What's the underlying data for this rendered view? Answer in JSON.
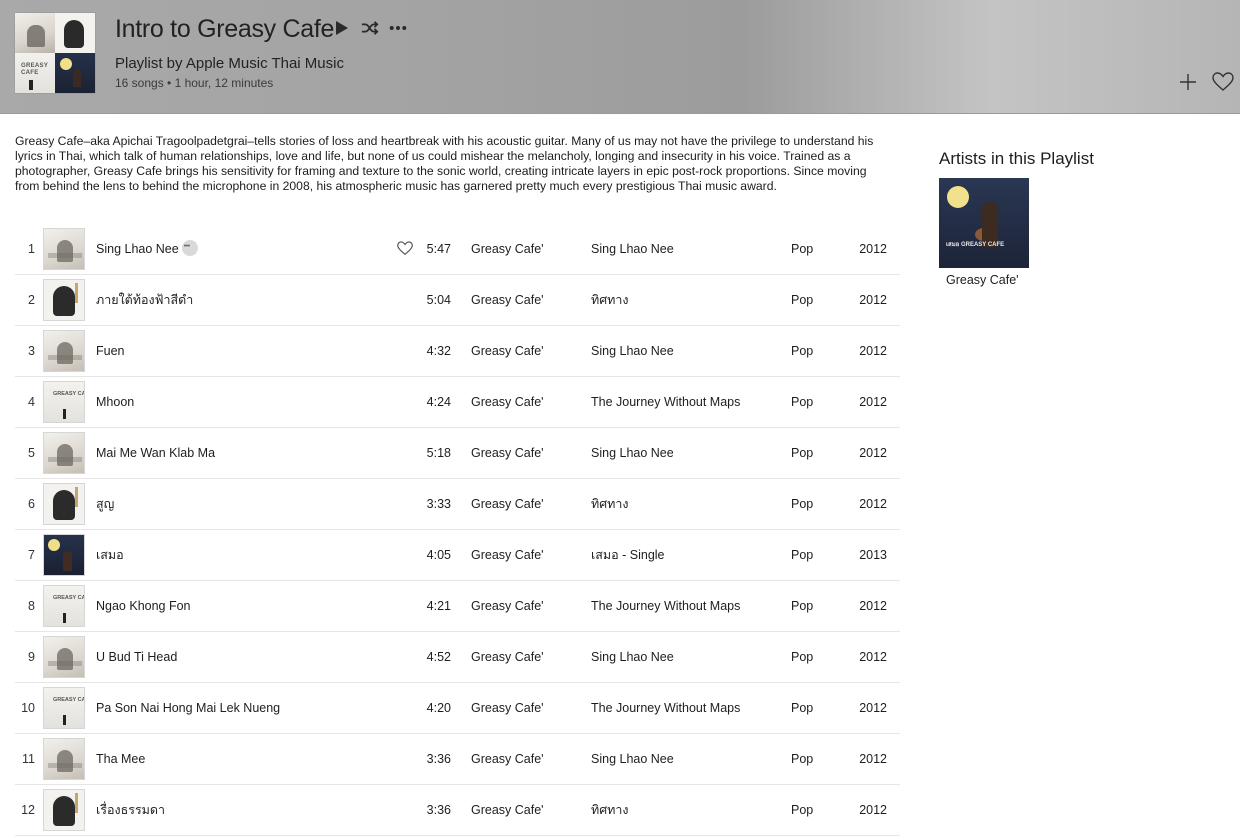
{
  "header": {
    "title": "Intro to Greasy Cafe",
    "subtitle": "Playlist by Apple Music Thai Music",
    "meta": "16 songs • 1 hour, 12 minutes",
    "cover_text": "GREASY CAFE"
  },
  "description": "Greasy Cafe–aka Apichai Tragoolpadetgrai–tells stories of loss and heartbreak with his acoustic guitar. Many of us may not have the privilege to understand his lyrics in Thai, which talk of human relationships, love and life, but none of us could mishear the melancholy, longing and insecurity in his voice. Trained as a photographer, Greasy Cafe brings his sensitivity for framing and texture to the sonic world, creating intricate layers in epic post-rock proportions. Since moving from behind the lens to behind the microphone in 2008, his atmospheric music has garnered pretty much every prestigious Thai music award.",
  "songs": [
    {
      "num": "1",
      "name": "Sing Lhao Nee",
      "time": "5:47",
      "artist": "Greasy Cafe'",
      "album": "Sing Lhao Nee",
      "genre": "Pop",
      "year": "2012",
      "art": "sing"
    },
    {
      "num": "2",
      "name": "ภายใต้ท้องฟ้าสีดำ",
      "time": "5:04",
      "artist": "Greasy Cafe'",
      "album": "ทิศทาง",
      "genre": "Pop",
      "year": "2012",
      "art": "tit"
    },
    {
      "num": "3",
      "name": "Fuen",
      "time": "4:32",
      "artist": "Greasy Cafe'",
      "album": "Sing Lhao Nee",
      "genre": "Pop",
      "year": "2012",
      "art": "sing"
    },
    {
      "num": "4",
      "name": "Mhoon",
      "time": "4:24",
      "artist": "Greasy Cafe'",
      "album": "The Journey Without Maps",
      "genre": "Pop",
      "year": "2012",
      "art": "jour"
    },
    {
      "num": "5",
      "name": "Mai Me Wan Klab Ma",
      "time": "5:18",
      "artist": "Greasy Cafe'",
      "album": "Sing Lhao Nee",
      "genre": "Pop",
      "year": "2012",
      "art": "sing"
    },
    {
      "num": "6",
      "name": "สูญ",
      "time": "3:33",
      "artist": "Greasy Cafe'",
      "album": "ทิศทาง",
      "genre": "Pop",
      "year": "2012",
      "art": "tit"
    },
    {
      "num": "7",
      "name": "เสมอ",
      "time": "4:05",
      "artist": "Greasy Cafe'",
      "album": "เสมอ - Single",
      "genre": "Pop",
      "year": "2013",
      "art": "samer"
    },
    {
      "num": "8",
      "name": "Ngao Khong Fon",
      "time": "4:21",
      "artist": "Greasy Cafe'",
      "album": "The Journey Without Maps",
      "genre": "Pop",
      "year": "2012",
      "art": "jour"
    },
    {
      "num": "9",
      "name": "U Bud Ti Head",
      "time": "4:52",
      "artist": "Greasy Cafe'",
      "album": "Sing Lhao Nee",
      "genre": "Pop",
      "year": "2012",
      "art": "sing"
    },
    {
      "num": "10",
      "name": "Pa Son Nai Hong Mai Lek Nueng",
      "time": "4:20",
      "artist": "Greasy Cafe'",
      "album": "The Journey Without Maps",
      "genre": "Pop",
      "year": "2012",
      "art": "jour"
    },
    {
      "num": "11",
      "name": "Tha Mee",
      "time": "3:36",
      "artist": "Greasy Cafe'",
      "album": "Sing Lhao Nee",
      "genre": "Pop",
      "year": "2012",
      "art": "sing"
    },
    {
      "num": "12",
      "name": "เรื่องธรรมดา",
      "time": "3:36",
      "artist": "Greasy Cafe'",
      "album": "ทิศทาง",
      "genre": "Pop",
      "year": "2012",
      "art": "tit"
    }
  ],
  "sidebar": {
    "title": "Artists in this Playlist",
    "artists": [
      {
        "name": "Greasy Cafe'",
        "image_label": "เสมอ GREASY CAFE"
      }
    ]
  },
  "icons": {
    "play": "play-icon",
    "shuffle": "shuffle-icon",
    "more": "more-icon",
    "add": "plus-icon",
    "love": "heart-icon"
  }
}
